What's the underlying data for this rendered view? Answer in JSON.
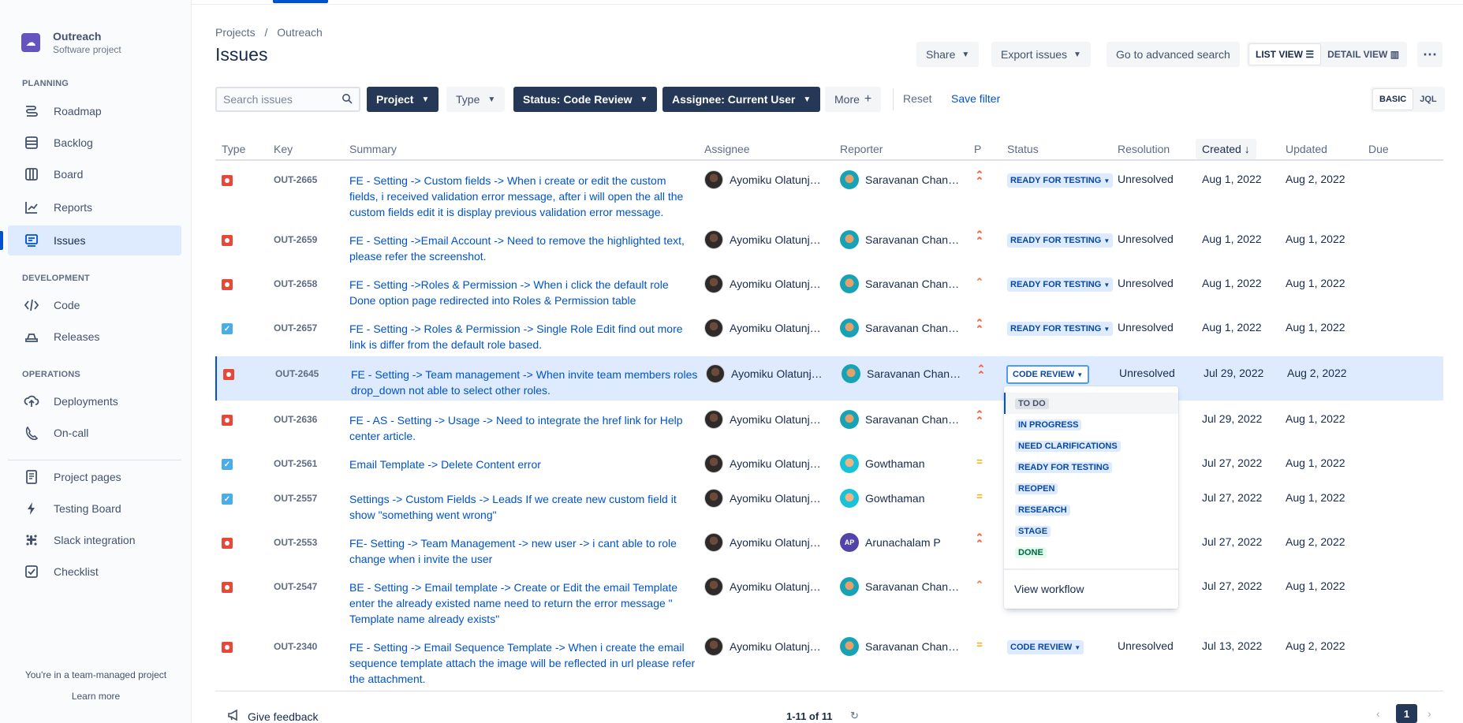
{
  "project": {
    "name": "Outreach",
    "type": "Software project"
  },
  "sidebar": {
    "sections": [
      {
        "title": "PLANNING",
        "items": [
          {
            "label": "Roadmap",
            "icon": "roadmap-icon"
          },
          {
            "label": "Backlog",
            "icon": "backlog-icon"
          },
          {
            "label": "Board",
            "icon": "board-icon"
          },
          {
            "label": "Reports",
            "icon": "reports-icon"
          },
          {
            "label": "Issues",
            "icon": "issues-icon",
            "active": true
          }
        ]
      },
      {
        "title": "DEVELOPMENT",
        "items": [
          {
            "label": "Code",
            "icon": "code-icon"
          },
          {
            "label": "Releases",
            "icon": "releases-icon"
          }
        ]
      },
      {
        "title": "OPERATIONS",
        "items": [
          {
            "label": "Deployments",
            "icon": "deployments-icon"
          },
          {
            "label": "On-call",
            "icon": "on-call-icon"
          }
        ]
      }
    ],
    "extra_items": [
      {
        "label": "Project pages",
        "icon": "project-pages-icon"
      },
      {
        "label": "Testing Board",
        "icon": "lightning-icon"
      },
      {
        "label": "Slack integration",
        "icon": "slack-icon"
      },
      {
        "label": "Checklist",
        "icon": "checklist-icon"
      }
    ],
    "footer_text": "You're in a team-managed project",
    "footer_link": "Learn more"
  },
  "header": {
    "breadcrumb": [
      "Projects",
      "Outreach"
    ],
    "breadcrumb_sep": "/",
    "title": "Issues",
    "share": "Share",
    "export": "Export issues",
    "advanced_search": "Go to advanced search",
    "list_view": "LIST VIEW",
    "detail_view": "DETAIL VIEW",
    "more_icon": "more-icon"
  },
  "filters": {
    "search_placeholder": "Search issues",
    "project": "Project",
    "type": "Type",
    "status": "Status: Code Review",
    "assignee": "Assignee: Current User",
    "more": "More",
    "reset": "Reset",
    "save_filter": "Save filter",
    "basic": "BASIC",
    "jql": "JQL"
  },
  "table": {
    "columns": [
      "Type",
      "Key",
      "Summary",
      "Assignee",
      "Reporter",
      "P",
      "Status",
      "Resolution",
      "Created",
      "Updated",
      "Due"
    ],
    "rows": [
      {
        "type": "bug",
        "key": "OUT-2665",
        "summary": "FE - Setting -> Custom fields -> When i create or edit the custom fields, i received validation error message, after i will open the all the custom fields edit it is display previous validation error message.",
        "assignee": "Ayomiku Olatunj…",
        "reporter": "Saravanan Chan…",
        "reporter_av": "sar",
        "priority": "high",
        "status": "READY FOR TESTING",
        "resolution": "Unresolved",
        "created": "Aug 1, 2022",
        "updated": "Aug 2, 2022"
      },
      {
        "type": "bug",
        "key": "OUT-2659",
        "summary": "FE - Setting ->Email Account -> Need to remove the highlighted text, please refer the screenshot.",
        "assignee": "Ayomiku Olatunj…",
        "reporter": "Saravanan Chan…",
        "reporter_av": "sar",
        "priority": "high",
        "status": "READY FOR TESTING",
        "resolution": "Unresolved",
        "created": "Aug 1, 2022",
        "updated": "Aug 1, 2022"
      },
      {
        "type": "bug",
        "key": "OUT-2658",
        "summary": "FE - Setting ->Roles & Permission -> When i click the default role Done option page redirected into Roles & Permission table",
        "assignee": "Ayomiku Olatunj…",
        "reporter": "Saravanan Chan…",
        "reporter_av": "sar",
        "priority": "medium-high",
        "status": "READY FOR TESTING",
        "resolution": "Unresolved",
        "created": "Aug 1, 2022",
        "updated": "Aug 1, 2022"
      },
      {
        "type": "task",
        "key": "OUT-2657",
        "summary": "FE - Setting -> Roles & Permission -> Single Role Edit find out more link is differ from the default role based.",
        "assignee": "Ayomiku Olatunj…",
        "reporter": "Saravanan Chan…",
        "reporter_av": "sar",
        "priority": "high",
        "status": "READY FOR TESTING",
        "resolution": "Unresolved",
        "created": "Aug 1, 2022",
        "updated": "Aug 1, 2022"
      },
      {
        "type": "bug",
        "key": "OUT-2645",
        "summary": "FE - Setting -> Team management -> When invite team members roles drop_down not able to select other roles.",
        "assignee": "Ayomiku Olatunj…",
        "reporter": "Saravanan Chan…",
        "reporter_av": "sar",
        "priority": "high",
        "status": "CODE REVIEW",
        "resolution": "Unresolved",
        "created": "Jul 29, 2022",
        "updated": "Aug 2, 2022",
        "selected": true
      },
      {
        "type": "bug",
        "key": "OUT-2636",
        "summary": "FE - AS - Setting -> Usage -> Need to integrate the href link for Help center article.",
        "assignee": "Ayomiku Olatunj…",
        "reporter": "Saravanan Chan…",
        "reporter_av": "sar",
        "priority": "high",
        "status": "",
        "resolution": "",
        "created": "Jul 29, 2022",
        "updated": "Aug 1, 2022"
      },
      {
        "type": "task",
        "key": "OUT-2561",
        "summary": "Email Template -> Delete Content error",
        "assignee": "Ayomiku Olatunj…",
        "reporter": "Gowthaman",
        "reporter_av": "gow",
        "priority": "medium",
        "status": "",
        "resolution": "",
        "created": "Jul 27, 2022",
        "updated": "Aug 1, 2022"
      },
      {
        "type": "task",
        "key": "OUT-2557",
        "summary": "Settings -> Custom Fields -> Leads If we create new custom field it show \"something went wrong\"",
        "assignee": "Ayomiku Olatunj…",
        "reporter": "Gowthaman",
        "reporter_av": "gow",
        "priority": "medium",
        "status": "",
        "resolution": "",
        "created": "Jul 27, 2022",
        "updated": "Aug 1, 2022"
      },
      {
        "type": "bug",
        "key": "OUT-2553",
        "summary": "FE- Setting -> Team Management -> new user -> i cant able to role change when i invite the user",
        "assignee": "Ayomiku Olatunj…",
        "reporter": "Arunachalam P",
        "reporter_av": "ap",
        "reporter_initials": "AP",
        "priority": "high",
        "status": "",
        "resolution": "",
        "created": "Jul 27, 2022",
        "updated": "Aug 2, 2022"
      },
      {
        "type": "bug",
        "key": "OUT-2547",
        "summary": "BE - Setting -> Email template -> Create or Edit the email Template enter the already existed name need to return the error message \" Template name already exists\"",
        "assignee": "Ayomiku Olatunj…",
        "reporter": "Saravanan Chan…",
        "reporter_av": "sar",
        "priority": "medium-high",
        "status": "",
        "resolution": "",
        "created": "Jul 27, 2022",
        "updated": "Aug 1, 2022"
      },
      {
        "type": "bug",
        "key": "OUT-2340",
        "summary": "FE - Setting -> Email Sequence Template -> When i create the email sequence template attach the image will be reflected in url please refer the attachment.",
        "assignee": "Ayomiku Olatunj…",
        "reporter": "Saravanan Chan…",
        "reporter_av": "sar",
        "priority": "medium",
        "status": "CODE REVIEW",
        "resolution": "Unresolved",
        "created": "Jul 13, 2022",
        "updated": "Aug 2, 2022"
      }
    ]
  },
  "status_dropdown": {
    "options": [
      {
        "label": "TO DO",
        "color": "grey"
      },
      {
        "label": "IN PROGRESS",
        "color": "blue"
      },
      {
        "label": "NEED CLARIFICATIONS",
        "color": "blue"
      },
      {
        "label": "READY FOR TESTING",
        "color": "blue"
      },
      {
        "label": "REOPEN",
        "color": "blue"
      },
      {
        "label": "RESEARCH",
        "color": "blue"
      },
      {
        "label": "STAGE",
        "color": "blue"
      },
      {
        "label": "DONE",
        "color": "green"
      }
    ],
    "view_workflow": "View workflow"
  },
  "footer": {
    "feedback": "Give feedback",
    "count": "1-11 of 11",
    "page": "1"
  },
  "colors": {
    "accent": "#0052CC",
    "dark_filter": "#253858",
    "bug": "#E5493A",
    "task": "#4BADE8",
    "priority_high": "#FF5630",
    "priority_medium": "#FFAB00"
  }
}
